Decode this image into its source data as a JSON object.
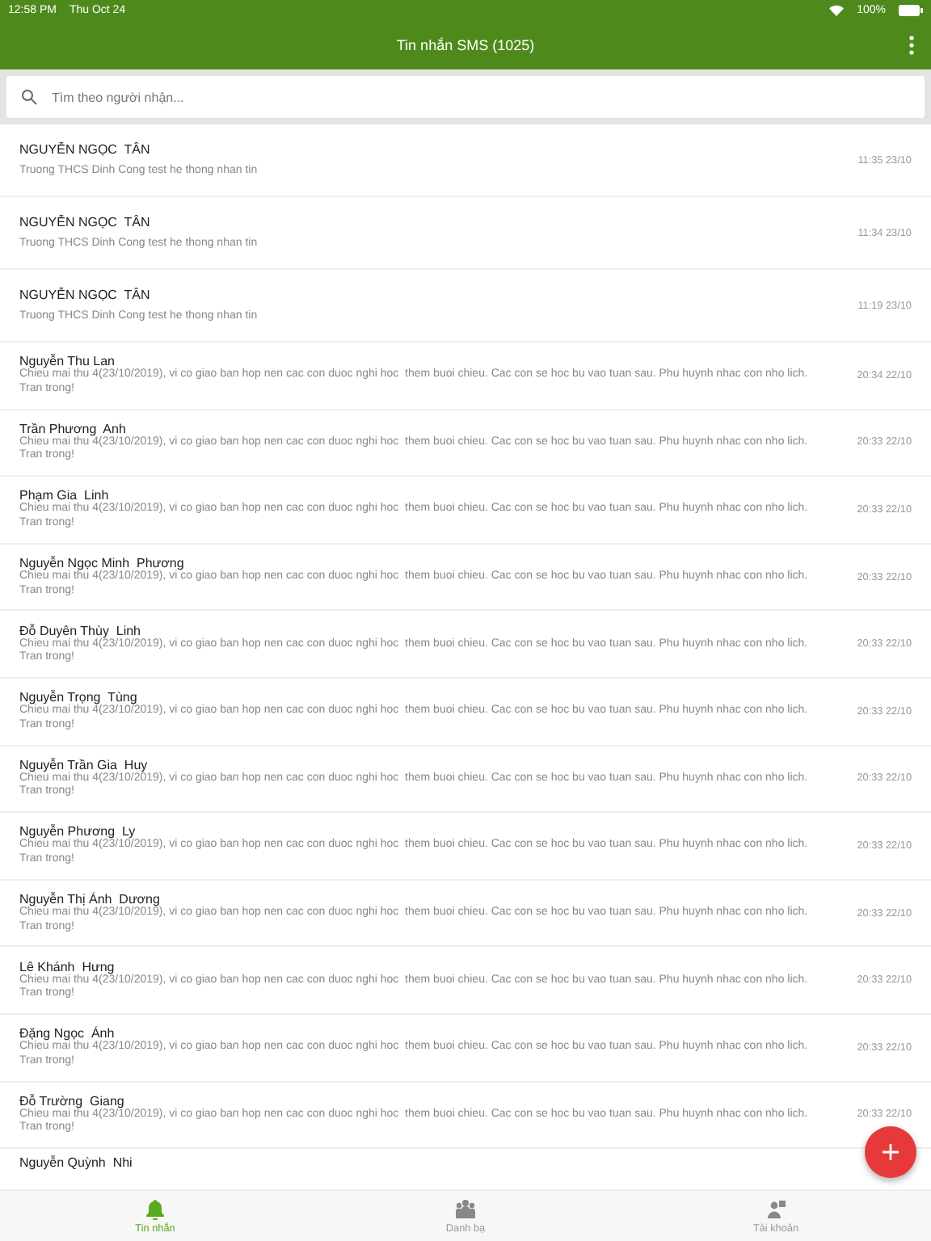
{
  "status_bar": {
    "time": "12:58 PM",
    "date": "Thu Oct 24",
    "battery": "100%"
  },
  "header": {
    "title": "Tin nhắn SMS (1025)"
  },
  "search": {
    "placeholder": "Tìm theo người nhận..."
  },
  "messages": [
    {
      "kind": "short",
      "name": "NGUYỄN NGỌC  TÂN",
      "preview": "Truong THCS Dinh Cong test he thong nhan tin",
      "time": "11:35 23/10"
    },
    {
      "kind": "short",
      "name": "NGUYỄN NGỌC  TÂN",
      "preview": "Truong THCS Dinh Cong test he thong nhan tin",
      "time": "11:34 23/10"
    },
    {
      "kind": "short",
      "name": "NGUYỄN NGỌC  TÂN",
      "preview": "Truong THCS Dinh Cong test he thong nhan tin",
      "time": "11:19 23/10"
    },
    {
      "kind": "long",
      "name": "Nguyễn Thu Lan",
      "preview": "Chieu mai thu 4(23/10/2019), vi co giao ban hop nen cac con duoc nghi hoc  them buoi chieu. Cac con se hoc bu vao tuan sau. Phu huynh nhac con nho lich. Tran trong!",
      "time": "20:34 22/10"
    },
    {
      "kind": "long",
      "name": "Trần Phương  Anh",
      "preview": "Chieu mai thu 4(23/10/2019), vi co giao ban hop nen cac con duoc nghi hoc  them buoi chieu. Cac con se hoc bu vao tuan sau. Phu huynh nhac con nho lich. Tran trong!",
      "time": "20:33 22/10"
    },
    {
      "kind": "long",
      "name": "Phạm Gia  Linh",
      "preview": "Chieu mai thu 4(23/10/2019), vi co giao ban hop nen cac con duoc nghi hoc  them buoi chieu. Cac con se hoc bu vao tuan sau. Phu huynh nhac con nho lich. Tran trong!",
      "time": "20:33 22/10"
    },
    {
      "kind": "long",
      "name": "Nguyễn Ngọc Minh  Phương",
      "preview": "Chieu mai thu 4(23/10/2019), vi co giao ban hop nen cac con duoc nghi hoc  them buoi chieu. Cac con se hoc bu vao tuan sau. Phu huynh nhac con nho lich. Tran trong!",
      "time": "20:33 22/10"
    },
    {
      "kind": "long",
      "name": "Đỗ Duyên Thùy  Linh",
      "preview": "Chieu mai thu 4(23/10/2019), vi co giao ban hop nen cac con duoc nghi hoc  them buoi chieu. Cac con se hoc bu vao tuan sau. Phu huynh nhac con nho lich. Tran trong!",
      "time": "20:33 22/10"
    },
    {
      "kind": "long",
      "name": "Nguyễn Trọng  Tùng",
      "preview": "Chieu mai thu 4(23/10/2019), vi co giao ban hop nen cac con duoc nghi hoc  them buoi chieu. Cac con se hoc bu vao tuan sau. Phu huynh nhac con nho lich. Tran trong!",
      "time": "20:33 22/10"
    },
    {
      "kind": "long",
      "name": "Nguyễn Trần Gia  Huy",
      "preview": "Chieu mai thu 4(23/10/2019), vi co giao ban hop nen cac con duoc nghi hoc  them buoi chieu. Cac con se hoc bu vao tuan sau. Phu huynh nhac con nho lich. Tran trong!",
      "time": "20:33 22/10"
    },
    {
      "kind": "long",
      "name": "Nguyễn Phương  Ly",
      "preview": "Chieu mai thu 4(23/10/2019), vi co giao ban hop nen cac con duoc nghi hoc  them buoi chieu. Cac con se hoc bu vao tuan sau. Phu huynh nhac con nho lich. Tran trong!",
      "time": "20:33 22/10"
    },
    {
      "kind": "long",
      "name": "Nguyễn Thị Ánh  Dương",
      "preview": "Chieu mai thu 4(23/10/2019), vi co giao ban hop nen cac con duoc nghi hoc  them buoi chieu. Cac con se hoc bu vao tuan sau. Phu huynh nhac con nho lich. Tran trong!",
      "time": "20:33 22/10"
    },
    {
      "kind": "long",
      "name": "Lê Khánh  Hưng",
      "preview": "Chieu mai thu 4(23/10/2019), vi co giao ban hop nen cac con duoc nghi hoc  them buoi chieu. Cac con se hoc bu vao tuan sau. Phu huynh nhac con nho lich. Tran trong!",
      "time": "20:33 22/10"
    },
    {
      "kind": "long",
      "name": "Đặng Ngọc  Ánh",
      "preview": "Chieu mai thu 4(23/10/2019), vi co giao ban hop nen cac con duoc nghi hoc  them buoi chieu. Cac con se hoc bu vao tuan sau. Phu huynh nhac con nho lich. Tran trong!",
      "time": "20:33 22/10"
    },
    {
      "kind": "long",
      "name": "Đỗ Trường  Giang",
      "preview": "Chieu mai thu 4(23/10/2019), vi co giao ban hop nen cac con duoc nghi hoc  them buoi chieu. Cac con se hoc bu vao tuan sau. Phu huynh nhac con nho lich. Tran trong!",
      "time": "20:33 22/10"
    },
    {
      "kind": "cut",
      "name": "Nguyễn Quỳnh  Nhi"
    }
  ],
  "tabs": [
    {
      "label": "Tin nhắn",
      "selected": true,
      "kind": "bell"
    },
    {
      "label": "Danh bạ",
      "selected": false,
      "kind": "people"
    },
    {
      "label": "Tài khoản",
      "selected": false,
      "kind": "account"
    }
  ]
}
